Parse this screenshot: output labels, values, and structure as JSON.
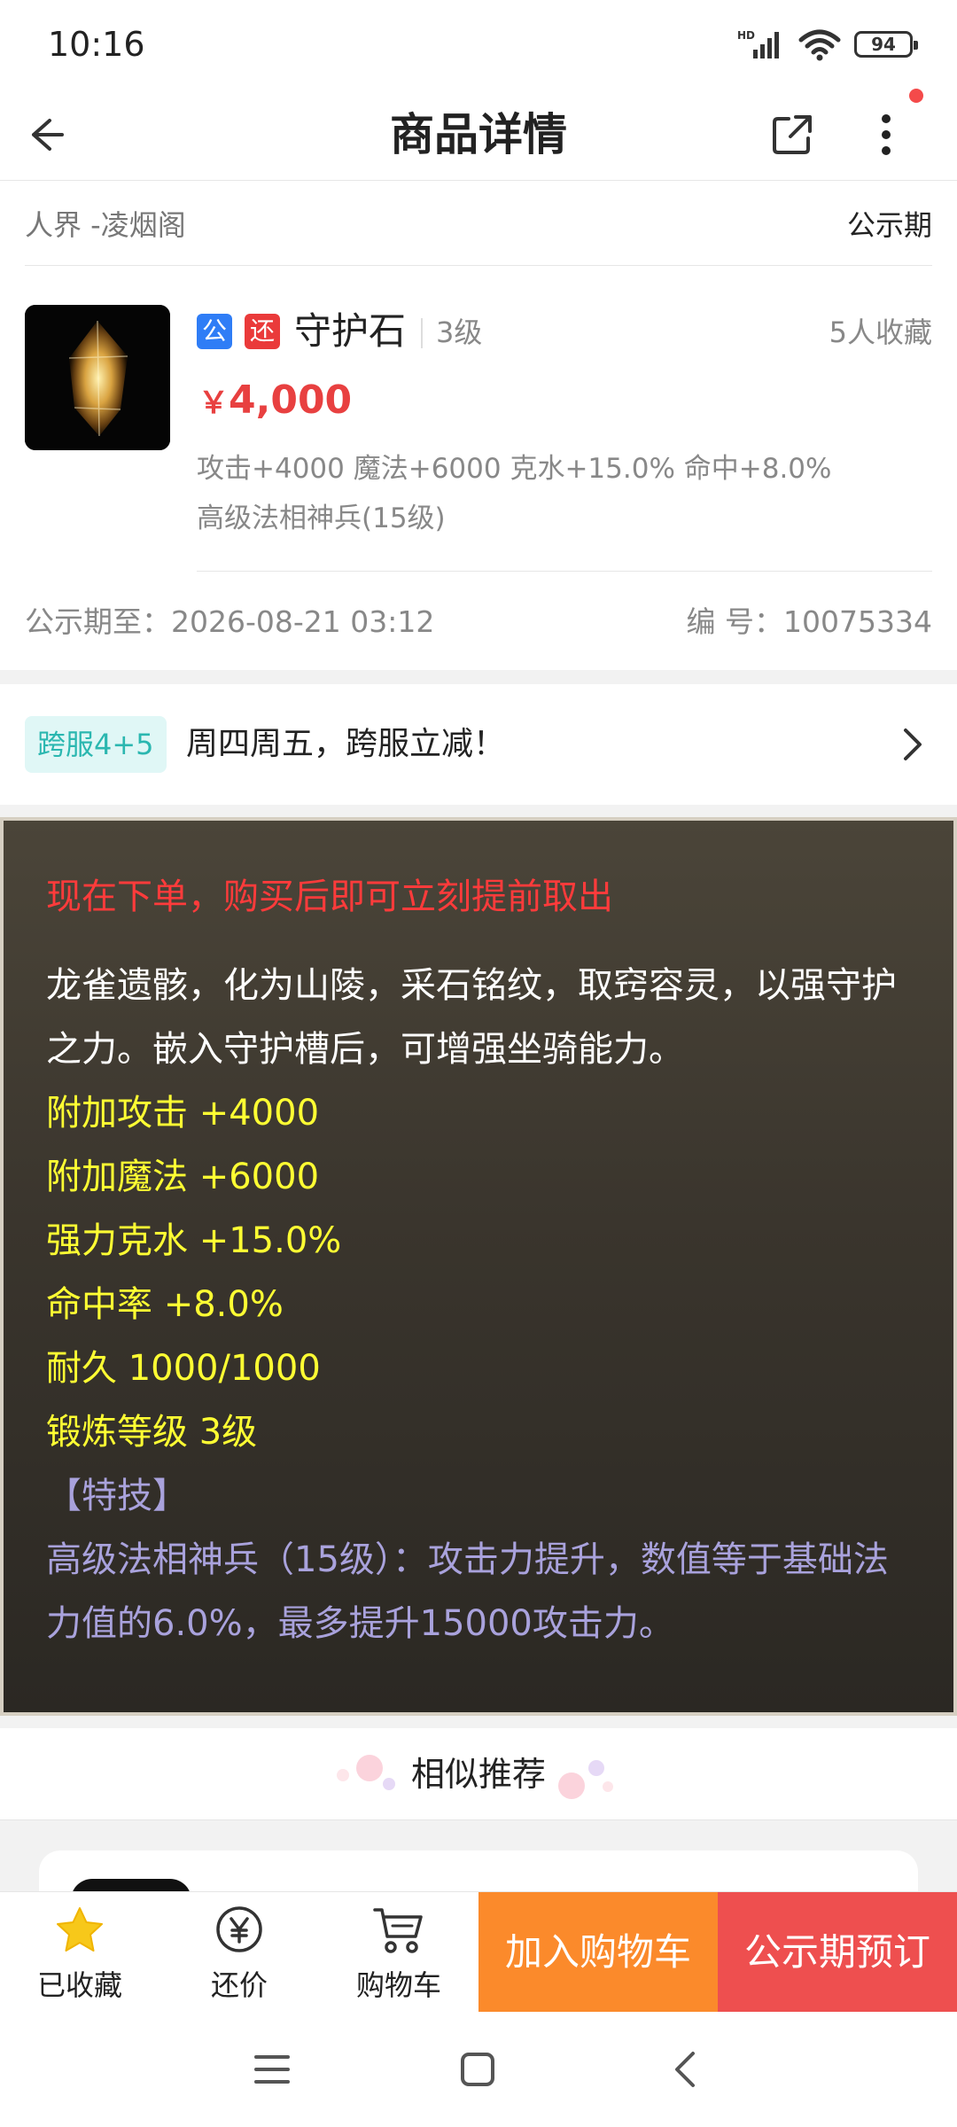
{
  "status_bar": {
    "time": "10:16",
    "network": "HD",
    "battery": "94"
  },
  "topbar": {
    "title": "商品详情",
    "back_icon": "back-arrow-icon",
    "share_icon": "share-icon",
    "more_icon": "more-vertical-icon"
  },
  "item": {
    "server": "人界 -凌烟阁",
    "phase": "公示期",
    "tag_public": "公",
    "tag_bargain": "还",
    "name": "守护石",
    "level": "3级",
    "favorites": "5人收藏",
    "currency": "￥",
    "price": "4,000",
    "attributes": "攻击+4000 魔法+6000 克水+15.0% 命中+8.0%",
    "skill": "高级法相神兵(15级)",
    "public_until": "公示期至：2026-08-21 03:12",
    "serial": "编 号：10075334"
  },
  "promo": {
    "badge": "跨服4+5",
    "text": "周四周五，跨服立减！"
  },
  "description": {
    "notice": "现在下单，购买后即可立刻提前取出",
    "lore": "龙雀遗骸，化为山陵，采石铭纹，取窍容灵，以强守护之力。嵌入守护槽后，可增强坐骑能力。",
    "stats": [
      "附加攻击 +4000",
      "附加魔法 +6000",
      "强力克水 +15.0%",
      "命中率 +8.0%",
      "耐久 1000/1000",
      "锻炼等级 3级"
    ],
    "special_header": "【特技】",
    "special_text": "高级法相神兵（15级）：攻击力提升，数值等于基础法力值的6.0%，最多提升15000攻击力。"
  },
  "similar": {
    "title": "相似推荐"
  },
  "bottom_bar": {
    "favorited": "已收藏",
    "bargain": "还价",
    "cart": "购物车",
    "add_to_cart": "加入购物车",
    "preorder": "公示期预订"
  },
  "colors": {
    "price_red": "#e84040",
    "orange": "#fb8a2b",
    "red_button": "#ee4f4f",
    "star_yellow": "#f7c81a"
  }
}
